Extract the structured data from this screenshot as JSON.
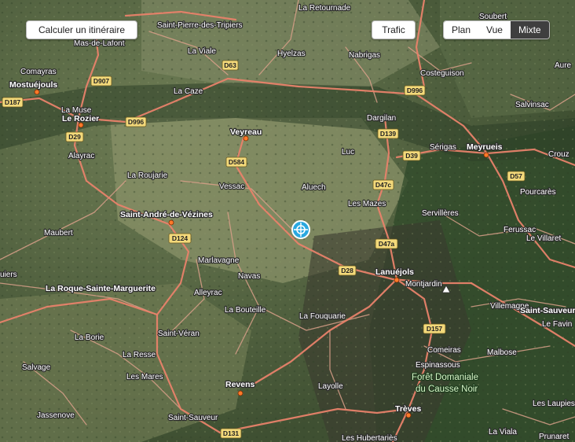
{
  "controls": {
    "route_label": "Calculer un itinéraire",
    "traffic_label": "Trafic",
    "map_types": [
      "Plan",
      "Vue",
      "Mixte"
    ],
    "active_map_type": "Mixte"
  },
  "places": {
    "la_retournade": "La Retournade",
    "saint_pierre": "Saint-Pierre-des-Tripiers",
    "mas_de_lafont": "Mas-de-Lafont",
    "comayras": "Comayras",
    "mostuejouls": "Mostuéjouls",
    "la_viale": "La Viale",
    "hyelzas": "Hyelzas",
    "nabrigas": "Nabrigas",
    "costeguison": "Costeguison",
    "la_muse": "La Muse",
    "le_rozier": "Le Rozier",
    "la_caze": "La Caze",
    "salvinsac": "Salvinsac",
    "dargilan": "Dargilan",
    "veyreau": "Veyreau",
    "luc": "Luc",
    "serigas": "Sérigas",
    "meyrueis": "Meyrueis",
    "alayrac": "Alayrac",
    "la_roujarie": "La Roujarie",
    "vessac": "Vessac",
    "aluech": "Aluech",
    "pourcares": "Pourcarès",
    "saint_andre": "Saint-André-de-Vézines",
    "les_mazes": "Les Mazes",
    "servilleres": "Servillères",
    "maubert": "Maubert",
    "ferussac": "Ferussac",
    "le_villaret": "Le Villaret",
    "marlavagne": "Marlavagne",
    "navas": "Navas",
    "lanuejols": "Lanuéjols",
    "montjardin": "Montjardin",
    "la_roque": "La Roque-Sainte-Marguerite",
    "alleyrac": "Alleyrac",
    "villemagne": "Villemagne",
    "saint_sauveur_e": "Saint-Sauveur",
    "la_bouteille": "La Bouteille",
    "la_fouquarie": "La Fouquarie",
    "le_favin": "Le Favin",
    "la_borie": "La Borie",
    "saint_veran": "Saint-Véran",
    "comeiras": "Comeiras",
    "malbose": "Malbose",
    "la_resse": "La Resse",
    "espinassous": "Espinassous",
    "salvage": "Salvage",
    "les_mares": "Les Mares",
    "foret_line1": "Forêt Domaniale",
    "foret_line2": "du Causse Noir",
    "revens": "Revens",
    "layolle": "Layolle",
    "les_laupies": "Les Laupies",
    "jassenove": "Jassenove",
    "saint_sauveur_s": "Saint-Sauveur",
    "treves": "Trèves",
    "la_viala": "La Viala",
    "prunaret": "Prunaret",
    "les_hubertaries": "Les Hubertariès",
    "soubert": "Soubert",
    "auree": "Aure",
    "crouz": "Crouz",
    "uiers": "uiers"
  },
  "roads": [
    "D907",
    "D187",
    "D63",
    "D996",
    "D996",
    "D29",
    "D139",
    "D39",
    "D584",
    "D47c",
    "D57",
    "D124",
    "D47a",
    "D28",
    "D157",
    "D131"
  ],
  "icons": {
    "marker": "location-crosshair-icon"
  },
  "colors": {
    "route": "#e8826a",
    "town": "#ff7a2a",
    "active_tab": "#3f3f3f"
  }
}
